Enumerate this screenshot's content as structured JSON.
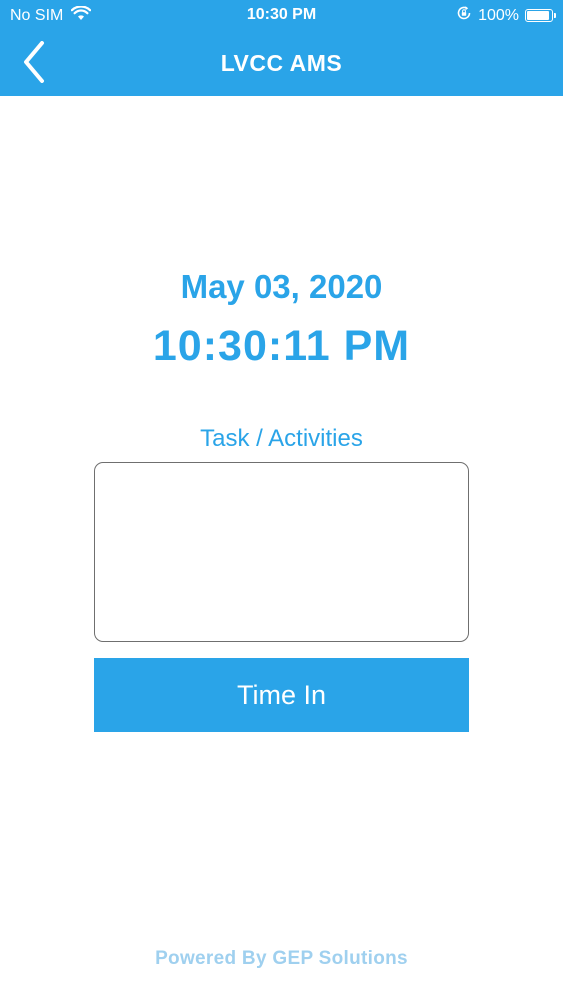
{
  "status_bar": {
    "carrier": "No SIM",
    "time": "10:30 PM",
    "battery_percent": "100%",
    "icons": [
      "wifi-icon",
      "orientation-lock-icon",
      "battery-icon"
    ]
  },
  "nav": {
    "title": "LVCC AMS",
    "back_icon": "chevron-left-icon"
  },
  "clock": {
    "date": "May 03, 2020",
    "time": "10:30:11 PM"
  },
  "task": {
    "label": "Task / Activities",
    "value": "",
    "placeholder": ""
  },
  "actions": {
    "time_in_label": "Time In"
  },
  "footer": {
    "text": "Powered By GEP Solutions"
  },
  "colors": {
    "primary": "#2aa4e8",
    "footer_text": "#9fd0ef",
    "input_border": "#6f6f6f"
  }
}
